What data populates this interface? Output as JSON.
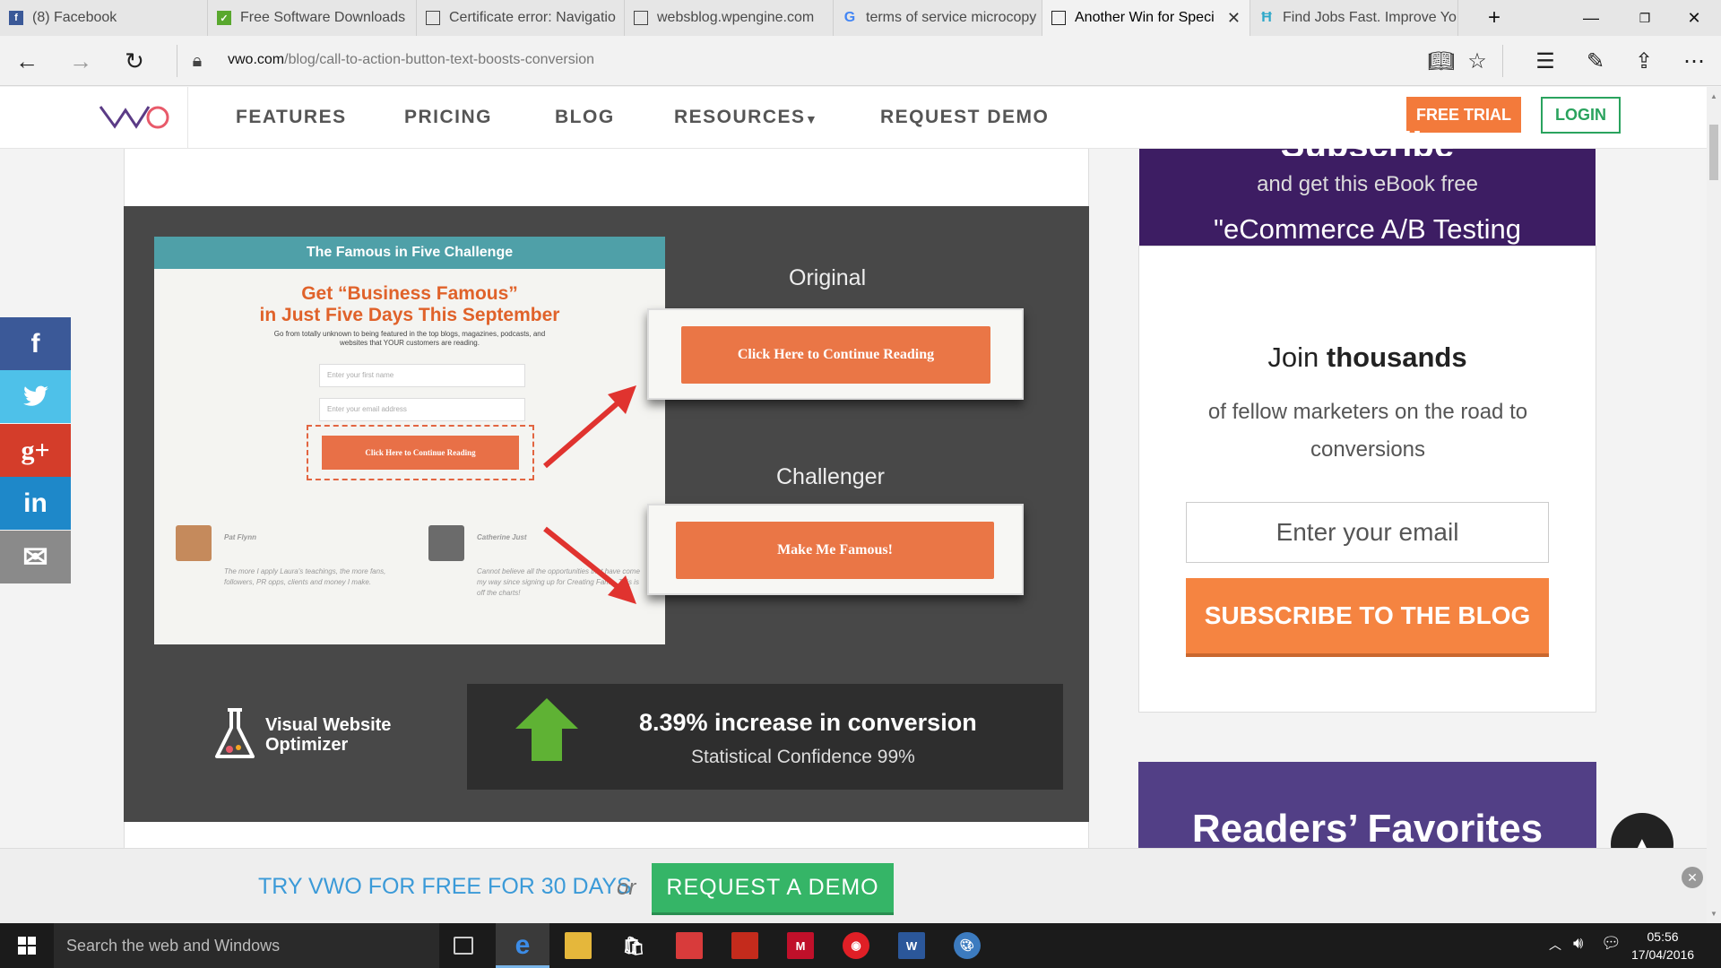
{
  "browser": {
    "tabs": [
      {
        "title": "(8) Facebook",
        "icon": "facebook-icon",
        "color": "#3b5998"
      },
      {
        "title": "Free Software Downloads",
        "icon": "download-site-icon",
        "color": "#59a82e"
      },
      {
        "title": "Certificate error: Navigatio",
        "icon": "page-icon",
        "color": "#555555"
      },
      {
        "title": "websblog.wpengine.com",
        "icon": "page-icon",
        "color": "#555555"
      },
      {
        "title": "terms of service microcopy",
        "icon": "google-icon",
        "color": "#4285f4"
      },
      {
        "title": "Another Win for Speci",
        "icon": "page-icon",
        "color": "#555555",
        "active": true
      },
      {
        "title": "Find Jobs Fast. Improve Yo",
        "icon": "jobs-site-icon",
        "color": "#2ea8c9"
      }
    ],
    "url_host": "vwo.com",
    "url_path": "/blog/call-to-action-button-text-boosts-conversion"
  },
  "site_nav": {
    "logo": "VWO",
    "links": [
      "FEATURES",
      "PRICING",
      "BLOG",
      "RESOURCES",
      "REQUEST DEMO"
    ],
    "free_trial": "FREE TRIAL",
    "login": "LOGIN",
    "accent": "#f37a3b",
    "green": "#2aa35e"
  },
  "figure": {
    "landing_header": "The Famous in Five Challenge",
    "landing_title_1": "Get “Business Famous”",
    "landing_title_2": "in Just Five Days This September",
    "landing_sub": "Go from totally unknown to being featured in the top blogs, magazines, podcasts, and websites that YOUR customers are reading.",
    "name_placeholder": "Enter your first name",
    "email_placeholder": "Enter your email address",
    "landing_cta": "Click Here to Continue Reading",
    "testimonial_1_name": "Pat Flynn",
    "testimonial_1": "The more I apply Laura's teachings, the more fans, followers, PR opps, clients and money I make.",
    "testimonial_2_name": "Catherine Just",
    "testimonial_2": "Cannot believe all the opportunities that have come my way since signing up for Creating Fame. This is off the charts!",
    "original_label": "Original",
    "original_button": "Click Here to Continue Reading",
    "challenger_label": "Challenger",
    "challenger_button": "Make Me Famous!",
    "vwo_brand_1": "Visual Website",
    "vwo_brand_2": "Optimizer",
    "result_headline": "8.39% increase in conversion",
    "result_sub": "Statistical Confidence 99%"
  },
  "sidebar": {
    "head_partial": "Subscribe",
    "head_line1": "and get this eBook free",
    "head_line2": "\"eCommerce A/B Testing",
    "join_1": "Join ",
    "join_2": "thousands",
    "join_sub": "of fellow marketers on the road to conversions",
    "email_placeholder": "Enter your email",
    "subscribe": "SUBSCRIBE TO THE BLOG",
    "readers_fav": "Readers’ Favorites"
  },
  "social": [
    {
      "name": "facebook-share-icon",
      "glyph": "f",
      "color": "#3b5998"
    },
    {
      "name": "twitter-share-icon",
      "glyph": "❧",
      "color": "#4ec1e9"
    },
    {
      "name": "googleplus-share-icon",
      "glyph": "g+",
      "color": "#d43d2a"
    },
    {
      "name": "linkedin-share-icon",
      "glyph": "in",
      "color": "#1e88c9"
    },
    {
      "name": "email-share-icon",
      "glyph": "✉",
      "color": "#8a8a8a"
    }
  ],
  "cta_bar": {
    "try": "TRY VWO FOR FREE FOR 30 DAYS",
    "or": "or",
    "request_demo": "REQUEST A DEMO"
  },
  "taskbar": {
    "search": "Search the web and Windows",
    "time": "05:56",
    "date": "17/04/2016"
  }
}
